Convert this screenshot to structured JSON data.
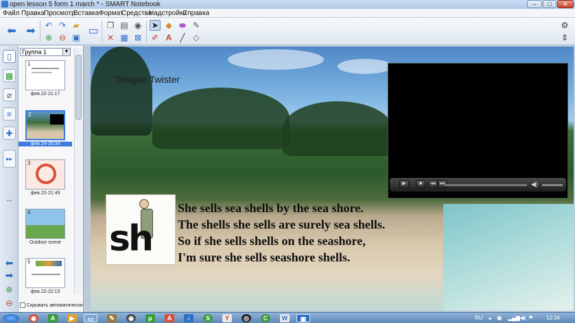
{
  "window": {
    "title": "open lesson 5 form 1 march * - SMART Notebook",
    "minimize_label": "–",
    "maximize_label": "□",
    "close_label": "✕"
  },
  "menu": [
    "Файл",
    "Правка",
    "Просмотр",
    "Вставка",
    "Формат",
    "Средства",
    "Надстройки",
    "Справка"
  ],
  "toolbar": {
    "icons": [
      "back-arrow-icon",
      "forward-arrow-icon",
      "undo-icon",
      "redo-icon",
      "open-icon",
      "add-page-icon",
      "delete-page-icon",
      "save-icon",
      "screen-display-icon",
      "paste-icon",
      "delete-icon",
      "table-icon",
      "screen-shade-icon",
      "select-pointer-icon",
      "fill-icon",
      "eraser-icon",
      "magic-pen-icon",
      "pens-icon",
      "text-icon",
      "line-icon",
      "shapes-eraser-icon",
      "gear-icon",
      "move-toolbar-icon"
    ]
  },
  "sorter": {
    "group": "Группа 1",
    "pages": [
      {
        "num": "1",
        "label": "фев.22-21:17"
      },
      {
        "num": "2",
        "label": "фев.24-20:34"
      },
      {
        "num": "3",
        "label": "фев.22-21:49"
      },
      {
        "num": "4",
        "label": "Outdoor scene"
      },
      {
        "num": "5",
        "label": "фев.22-22:15"
      }
    ],
    "auto_hide": "Скрывать автоматически"
  },
  "slide": {
    "title": "Tongue Twister",
    "sh": "sh",
    "rhyme": [
      "She sells sea shells by the sea shore.",
      "The shells she sells are surely sea shells.",
      "So if she sells shells on the seashore,",
      "I'm sure she sells seashore shells."
    ]
  },
  "taskbar": {
    "language": "RU",
    "clock": "12:34"
  },
  "colors": {
    "accent": "#3d7be0",
    "close_red": "#c7432a"
  }
}
